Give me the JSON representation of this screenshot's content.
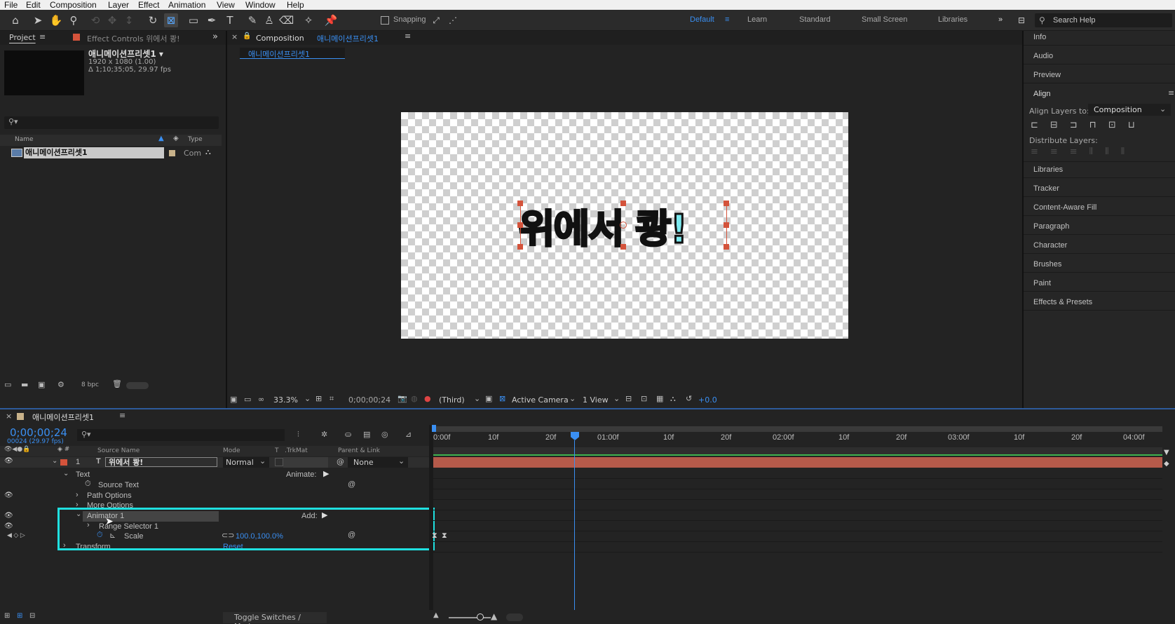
{
  "menu": [
    "File",
    "Edit",
    "Composition",
    "Layer",
    "Effect",
    "Animation",
    "View",
    "Window",
    "Help"
  ],
  "toolbar": {
    "snapping_label": "Snapping",
    "workspaces": [
      "Default",
      "Learn",
      "Standard",
      "Small Screen",
      "Libraries"
    ],
    "active_workspace": "Default",
    "search_placeholder": "Search Help",
    "more": "»"
  },
  "project": {
    "tab_project": "Project",
    "tab_effect_controls": "Effect Controls 위에서 쾅!",
    "comp_name": "애니메이션프리셋1 ▾",
    "comp_size": "1920 x 1080 (1.00)",
    "comp_duration": "Δ 1;10;35;05, 29.97 fps",
    "col_name": "Name",
    "col_type": "Type",
    "item_name": "애니메이션프리셋1",
    "item_type": "Com",
    "bpc": "8 bpc"
  },
  "viewer": {
    "tab_label": "Composition",
    "tab_comp": "애니메이션프리셋1",
    "sub_tab": "애니메이션프리셋1",
    "comp_text": "위에서 쾅!",
    "zoom": "33.3%",
    "timecode": "0;00;00;24",
    "resolution": "(Third)",
    "camera": "Active Camera",
    "views": "1 View",
    "exposure": "+0.0"
  },
  "right_panel": {
    "items_top": [
      "Info",
      "Audio",
      "Preview",
      "Align"
    ],
    "align_layers_to_label": "Align Layers to:",
    "align_layers_to_value": "Composition",
    "distribute_label": "Distribute Layers:",
    "items_bottom": [
      "Libraries",
      "Tracker",
      "Content-Aware Fill",
      "Paragraph",
      "Character",
      "Brushes",
      "Paint",
      "Effects & Presets"
    ]
  },
  "timeline": {
    "tab_label": "애니메이션프리셋1",
    "timecode": "0;00;00;24",
    "frames_fps": "00024 (29.97 fps)",
    "columns": {
      "source_name": "Source Name",
      "mode": "Mode",
      "t": "T",
      "trkmat": ".TrkMat",
      "parent": "Parent & Link"
    },
    "layer_index": "1",
    "layer_name": "위에서 쾅!",
    "layer_mode": "Normal",
    "layer_parent": "None",
    "rows": {
      "text": "Text",
      "animate": "Animate:",
      "source_text": "Source Text",
      "path_options": "Path Options",
      "more_options": "More Options",
      "animator": "Animator 1",
      "add": "Add:",
      "range_selector": "Range Selector 1",
      "scale": "Scale",
      "scale_value": "100.0,100.0%",
      "transform": "Transform",
      "reset": "Reset"
    },
    "ruler": [
      "0:00f",
      "10f",
      "20f",
      "01:00f",
      "10f",
      "20f",
      "02:00f",
      "10f",
      "20f",
      "03:00f",
      "10f",
      "20f",
      "04:00f"
    ],
    "toggle_label": "Toggle Switches / Modes"
  }
}
